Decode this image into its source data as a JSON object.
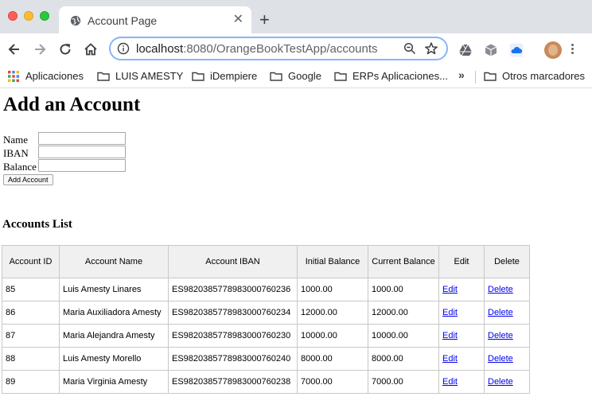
{
  "browser": {
    "tab_title": "Account Page",
    "tab_close": "✕",
    "new_tab": "+",
    "url_host": "localhost",
    "url_rest": ":8080/OrangeBookTestApp/accounts",
    "bookmarks": [
      {
        "label": "Aplicaciones"
      },
      {
        "label": "LUIS AMESTY"
      },
      {
        "label": "iDempiere"
      },
      {
        "label": "Google"
      },
      {
        "label": "ERPs Aplicaciones..."
      },
      {
        "label": "Otros marcadores"
      }
    ],
    "overflow": "»"
  },
  "form": {
    "title": "Add an Account",
    "name_label": "Name",
    "iban_label": "IBAN",
    "balance_label": "Balance",
    "name_value": "",
    "iban_value": "",
    "balance_value": "",
    "submit_label": "Add Account"
  },
  "list": {
    "title": "Accounts List",
    "headers": [
      "Account ID",
      "Account Name",
      "Account IBAN",
      "Initial Balance",
      "Current Balance",
      "Edit",
      "Delete"
    ],
    "rows": [
      {
        "id": "85",
        "name": "Luis Amesty Linares",
        "iban": "ES9820385778983000760236",
        "initial": "1000.00",
        "current": "1000.00",
        "edit": "Edit",
        "delete": "Delete"
      },
      {
        "id": "86",
        "name": "Maria Auxiliadora Amesty",
        "iban": "ES9820385778983000760234",
        "initial": "12000.00",
        "current": "12000.00",
        "edit": "Edit",
        "delete": "Delete"
      },
      {
        "id": "87",
        "name": "Maria Alejandra Amesty",
        "iban": "ES9820385778983000760230",
        "initial": "10000.00",
        "current": "10000.00",
        "edit": "Edit",
        "delete": "Delete"
      },
      {
        "id": "88",
        "name": "Luis Amesty Morello",
        "iban": "ES9820385778983000760240",
        "initial": "8000.00",
        "current": "8000.00",
        "edit": "Edit",
        "delete": "Delete"
      },
      {
        "id": "89",
        "name": "Maria Virginia Amesty",
        "iban": "ES9820385778983000760238",
        "initial": "7000.00",
        "current": "7000.00",
        "edit": "Edit",
        "delete": "Delete"
      }
    ]
  },
  "colors": {
    "link": "#0000ee",
    "header_bg": "#f0f0f0",
    "omnibox_focus": "#8ab4f8"
  }
}
